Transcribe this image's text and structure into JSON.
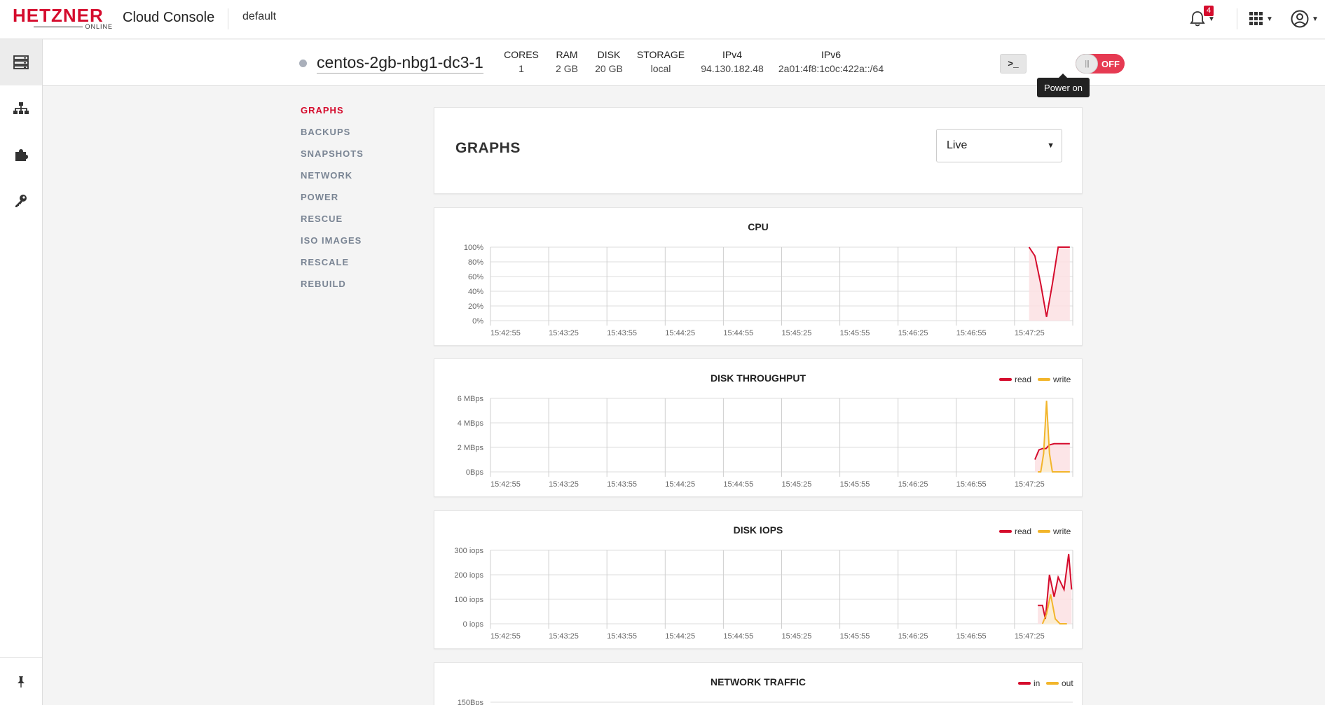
{
  "topbar": {
    "brand": "HETZNER",
    "brand_sub": "ONLINE",
    "app_title": "Cloud Console",
    "project": "default",
    "notifications_count": "4"
  },
  "server": {
    "name": "centos-2gb-nbg1-dc3-1",
    "specs": [
      {
        "key": "CORES",
        "value": "1"
      },
      {
        "key": "RAM",
        "value": "2 GB"
      },
      {
        "key": "DISK",
        "value": "20 GB"
      },
      {
        "key": "STORAGE",
        "value": "local"
      },
      {
        "key": "IPv4",
        "value": "94.130.182.48"
      },
      {
        "key": "IPv6",
        "value": "2a01:4f8:1c0c:422a::/64"
      }
    ],
    "console_label": ">_",
    "power_state": "OFF",
    "power_tooltip": "Power on"
  },
  "subnav": [
    "GRAPHS",
    "BACKUPS",
    "SNAPSHOTS",
    "NETWORK",
    "POWER",
    "RESCUE",
    "ISO IMAGES",
    "RESCALE",
    "REBUILD"
  ],
  "graphs": {
    "heading": "GRAPHS",
    "range_selected": "Live"
  },
  "colors": {
    "red": "#d50c2d",
    "yellow": "#f2b52b",
    "area_red": "#fbe1e3",
    "area_yellow": "#fcefd0"
  },
  "chart_data": [
    {
      "type": "area",
      "title": "CPU",
      "yticks": [
        "100%",
        "80%",
        "60%",
        "40%",
        "20%",
        "0%"
      ],
      "ylim": [
        0,
        100
      ],
      "xticks": [
        "15:42:55",
        "15:43:25",
        "15:43:55",
        "15:44:25",
        "15:44:55",
        "15:45:25",
        "15:45:55",
        "15:46:25",
        "15:46:55",
        "15:47:25"
      ],
      "legend": [],
      "series": [
        {
          "color": "red",
          "x": [
            0.925,
            0.935,
            0.945,
            0.955,
            0.965,
            0.975,
            0.985,
            0.995
          ],
          "y": [
            100,
            88,
            50,
            5,
            50,
            100,
            100,
            100
          ]
        }
      ]
    },
    {
      "type": "area",
      "title": "DISK THROUGHPUT",
      "yticks": [
        "6 MBps",
        "4 MBps",
        "2 MBps",
        "0Bps"
      ],
      "ylim": [
        0,
        6
      ],
      "xticks": [
        "15:42:55",
        "15:43:25",
        "15:43:55",
        "15:44:25",
        "15:44:55",
        "15:45:25",
        "15:45:55",
        "15:46:25",
        "15:46:55",
        "15:47:25"
      ],
      "legend": [
        {
          "label": "read",
          "color": "red"
        },
        {
          "label": "write",
          "color": "yellow"
        }
      ],
      "series": [
        {
          "color": "red",
          "x": [
            0.935,
            0.942,
            0.948,
            0.954,
            0.96,
            0.968,
            0.98,
            0.995
          ],
          "y": [
            1.0,
            1.8,
            1.9,
            1.9,
            2.2,
            2.3,
            2.3,
            2.3
          ]
        },
        {
          "color": "yellow",
          "x": [
            0.94,
            0.945,
            0.95,
            0.955,
            0.96,
            0.965,
            0.975,
            0.995
          ],
          "y": [
            0,
            0,
            1.5,
            5.8,
            1.5,
            0,
            0,
            0
          ]
        }
      ]
    },
    {
      "type": "area",
      "title": "DISK IOPS",
      "yticks": [
        "300 iops",
        "200 iops",
        "100 iops",
        "0 iops"
      ],
      "ylim": [
        0,
        300
      ],
      "xticks": [
        "15:42:55",
        "15:43:25",
        "15:43:55",
        "15:44:25",
        "15:44:55",
        "15:45:25",
        "15:45:55",
        "15:46:25",
        "15:46:55",
        "15:47:25"
      ],
      "legend": [
        {
          "label": "read",
          "color": "red"
        },
        {
          "label": "write",
          "color": "yellow"
        }
      ],
      "series": [
        {
          "color": "red",
          "x": [
            0.94,
            0.948,
            0.953,
            0.96,
            0.968,
            0.975,
            0.985,
            0.993,
            0.998
          ],
          "y": [
            75,
            75,
            20,
            200,
            110,
            190,
            140,
            285,
            140
          ]
        },
        {
          "color": "yellow",
          "x": [
            0.948,
            0.955,
            0.962,
            0.97,
            0.978,
            0.99
          ],
          "y": [
            0,
            40,
            120,
            20,
            0,
            0
          ]
        }
      ]
    },
    {
      "type": "area",
      "title": "NETWORK TRAFFIC",
      "yticks": [
        "150Bps"
      ],
      "ylim": [
        0,
        150
      ],
      "xticks": [],
      "legend": [
        {
          "label": "in",
          "color": "red"
        },
        {
          "label": "out",
          "color": "yellow"
        }
      ],
      "series": []
    }
  ]
}
